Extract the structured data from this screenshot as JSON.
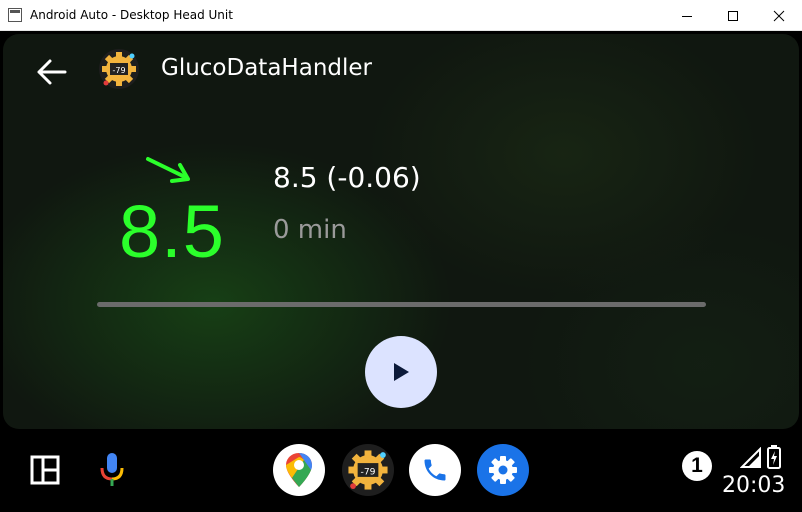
{
  "window": {
    "title": "Android Auto - Desktop Head Unit"
  },
  "header": {
    "app_title": "GlucoDataHandler",
    "app_icon_text": "-79"
  },
  "reading": {
    "value": "8.5",
    "delta_line": "8.5 (-0.06)",
    "age": "0 min",
    "trend": "slightly-falling-arrow",
    "value_color": "#2bff2b",
    "progress_fraction": 1.0
  },
  "controls": {
    "play_icon": "play-icon"
  },
  "rail": {
    "apps": [
      "dashboard-icon",
      "microphone-icon",
      "google-maps-icon",
      "glucodatahandler-icon",
      "phone-icon",
      "settings-icon"
    ],
    "notification_count": "1",
    "clock": "20:03"
  },
  "colors": {
    "accent_green": "#2bff2b",
    "play_button": "#dce3ff",
    "settings_blue": "#1a73e8"
  }
}
